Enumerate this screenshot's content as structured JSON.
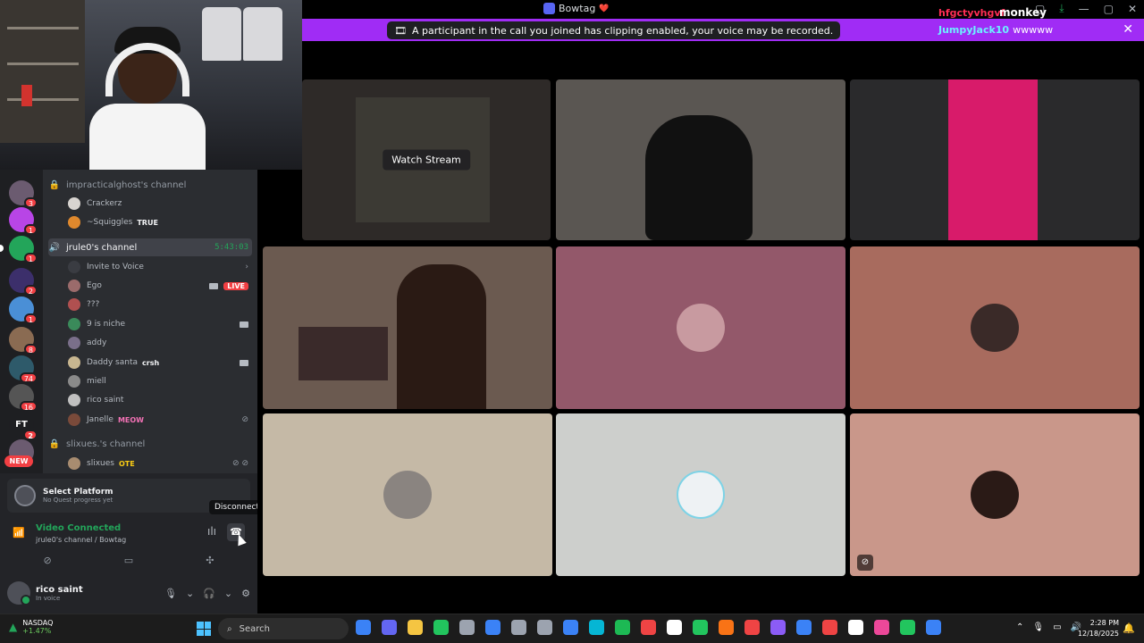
{
  "titlebar": {
    "server_name": "Bowtag",
    "heart": "❤️"
  },
  "overlay": {
    "red_text": "hfgctyvhgvf",
    "white_text": "monkey"
  },
  "notice": {
    "message": "A participant in the call you joined has clipping enabled, your voice may be recorded.",
    "chat_user": "JumpyJack10",
    "chat_text": "wwwww",
    "close_icon": "✕"
  },
  "rail": {
    "badges": [
      "3",
      "1",
      "1",
      "2",
      "1",
      "8",
      "74",
      "16",
      "2"
    ],
    "ft_label": "FT",
    "new_label": "NEW"
  },
  "channels": {
    "ch1": {
      "name": "impracticalghost's channel"
    },
    "ch1_users": [
      {
        "name": "Crackerz",
        "tag": ""
      },
      {
        "name": "~Squiggles",
        "tag": "TRUE"
      }
    ],
    "ch2": {
      "name": "jrule0's channel",
      "time": "5:43:03"
    },
    "invite": "Invite to Voice",
    "ch2_users": [
      {
        "name": "Ego",
        "tag": "",
        "live": "LIVE"
      },
      {
        "name": "???",
        "tag": ""
      },
      {
        "name": "9 is niche",
        "tag": ""
      },
      {
        "name": "addy",
        "tag": ""
      },
      {
        "name": "Daddy santa",
        "tag": "crsh"
      },
      {
        "name": "miell",
        "tag": ""
      },
      {
        "name": "rico saint",
        "tag": ""
      },
      {
        "name": "Janelle",
        "tag": "MEOW"
      }
    ],
    "ch3": {
      "name": "slixues.'s channel"
    },
    "ch3_users": [
      {
        "name": "slixues",
        "tag": "OTE"
      }
    ]
  },
  "quest": {
    "title": "Select Platform",
    "subtitle": "No Quest progress yet"
  },
  "voice": {
    "status": "Video Connected",
    "location": "jrule0's channel / Bowtag",
    "disconnect_tooltip": "Disconnect"
  },
  "user": {
    "name": "rico saint",
    "status": "In voice"
  },
  "grid": {
    "watch_stream": "Watch Stream",
    "tile_colors": [
      "#3a3533",
      "#2a2826",
      "#2c2c2e",
      "#6b5a50",
      "#93586a",
      "#a86b5e",
      "#c5b9a6",
      "#cdcfcc",
      "#c9978a"
    ]
  },
  "taskbar": {
    "stock_name": "NASDAQ",
    "stock_change": "+1.47%",
    "search_placeholder": "Search",
    "time": "2:28 PM",
    "date": "12/18/2025",
    "app_colors": [
      "#3b82f6",
      "#6366f1",
      "#f5c542",
      "#22c55e",
      "#9ca3af",
      "#3b82f6",
      "#9ca3af",
      "#9ca3af",
      "#3b82f6",
      "#06b6d4",
      "#1db954",
      "#ef4444",
      "#ffffff",
      "#22c55e",
      "#f97316",
      "#ef4444",
      "#8b5cf6",
      "#3b82f6",
      "#ef4444",
      "#ffffff",
      "#ec4899",
      "#22c55e",
      "#3b82f6"
    ]
  }
}
